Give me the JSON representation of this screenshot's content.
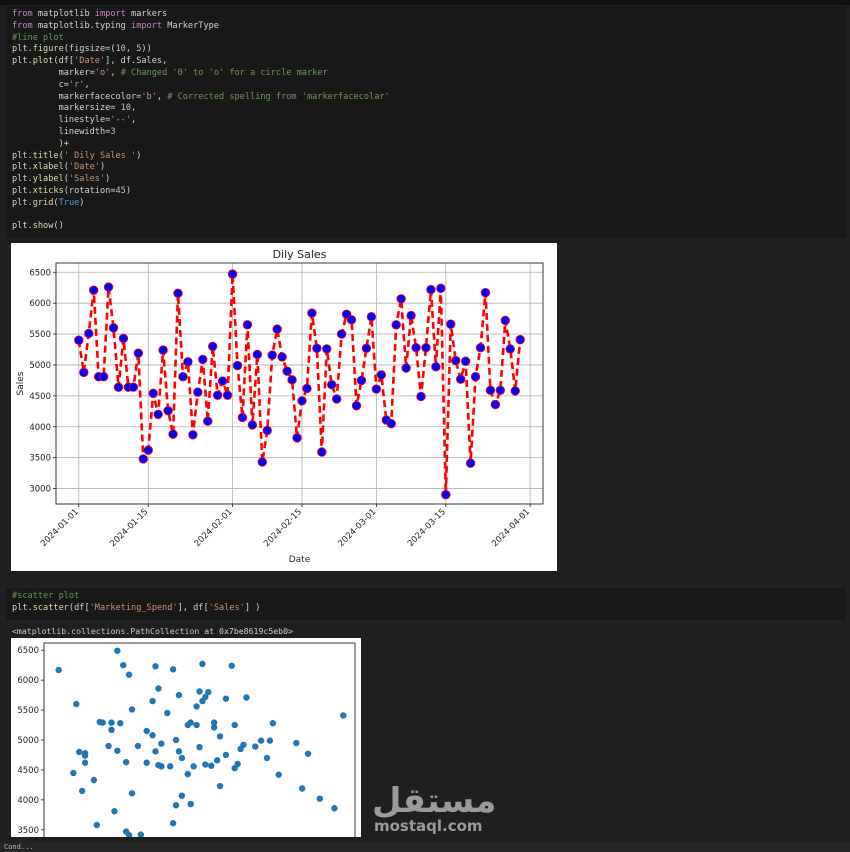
{
  "code_cell_1": [
    [
      [
        "kw",
        "from"
      ],
      [
        "t",
        " matplotlib "
      ],
      [
        "kw",
        "import"
      ],
      [
        "t",
        " markers"
      ]
    ],
    [
      [
        "kw",
        "from"
      ],
      [
        "t",
        " matplotlib.typing "
      ],
      [
        "kw",
        "import"
      ],
      [
        "t",
        " MarkerType"
      ]
    ],
    [
      [
        "cm",
        "#line plot"
      ]
    ],
    [
      [
        "t",
        "plt."
      ],
      [
        "fn",
        "figure"
      ],
      [
        "t",
        "(figsize=("
      ],
      [
        "num",
        "10"
      ],
      [
        "t",
        ", "
      ],
      [
        "num",
        "5"
      ],
      [
        "t",
        "))"
      ]
    ],
    [
      [
        "t",
        "plt."
      ],
      [
        "fn",
        "plot"
      ],
      [
        "t",
        "(df["
      ],
      [
        "str",
        "'Date'"
      ],
      [
        "t",
        "], df.Sales,"
      ]
    ],
    [
      [
        "t",
        "         marker="
      ],
      [
        "str",
        "'o'"
      ],
      [
        "t",
        ", "
      ],
      [
        "cm",
        "# Changed '0' to 'o' for a circle marker"
      ]
    ],
    [
      [
        "t",
        "         c="
      ],
      [
        "str",
        "'r'"
      ],
      [
        "t",
        ","
      ]
    ],
    [
      [
        "t",
        "         markerfacecolor="
      ],
      [
        "str",
        "'b'"
      ],
      [
        "t",
        ", "
      ],
      [
        "cm",
        "# Corrected spelling from 'markerfacecolar'"
      ]
    ],
    [
      [
        "t",
        "         markersize= "
      ],
      [
        "num",
        "10"
      ],
      [
        "t",
        ","
      ]
    ],
    [
      [
        "t",
        "         linestyle="
      ],
      [
        "str",
        "'--'"
      ],
      [
        "t",
        ","
      ]
    ],
    [
      [
        "t",
        "         linewidth="
      ],
      [
        "num",
        "3"
      ]
    ],
    [
      [
        "t",
        "         )+"
      ]
    ],
    [
      [
        "t",
        "plt."
      ],
      [
        "fn",
        "title"
      ],
      [
        "t",
        "("
      ],
      [
        "str",
        "' Dily Sales '"
      ],
      [
        "t",
        ")"
      ]
    ],
    [
      [
        "t",
        "plt."
      ],
      [
        "fn",
        "xlabel"
      ],
      [
        "t",
        "("
      ],
      [
        "str",
        "'Date'"
      ],
      [
        "t",
        ")"
      ]
    ],
    [
      [
        "t",
        "plt."
      ],
      [
        "fn",
        "ylabel"
      ],
      [
        "t",
        "("
      ],
      [
        "str",
        "'Sales'"
      ],
      [
        "t",
        ")"
      ]
    ],
    [
      [
        "t",
        "plt."
      ],
      [
        "fn",
        "xticks"
      ],
      [
        "t",
        "(rotation="
      ],
      [
        "num",
        "45"
      ],
      [
        "t",
        ")"
      ]
    ],
    [
      [
        "t",
        "plt."
      ],
      [
        "fn",
        "grid"
      ],
      [
        "t",
        "("
      ],
      [
        "cn",
        "True"
      ],
      [
        "t",
        ")"
      ]
    ],
    [
      [
        "t",
        ""
      ]
    ],
    [
      [
        "t",
        "plt."
      ],
      [
        "fn",
        "show"
      ],
      [
        "t",
        "()"
      ]
    ]
  ],
  "code_cell_2": [
    [
      [
        "cm",
        "#scatter plot"
      ]
    ],
    [
      [
        "t",
        "plt."
      ],
      [
        "fn",
        "scatter"
      ],
      [
        "t",
        "(df["
      ],
      [
        "str",
        "'Marketing_Spend'"
      ],
      [
        "t",
        "], df["
      ],
      [
        "str",
        "'Sales'"
      ],
      [
        "t",
        "] )"
      ]
    ]
  ],
  "scatter_output_text": "<matplotlib.collections.PathCollection at 0x7be8619c5eb0>",
  "watermark": {
    "arabic": "مستقل",
    "latin": "mostaql.com"
  },
  "bottom_label": "Cond...",
  "colors": {
    "line": "#ff0000",
    "marker_face": "#0000ff",
    "scatter": "#1f77b4"
  },
  "chart_data": [
    {
      "type": "line",
      "title": "Dily Sales",
      "xlabel": "Date",
      "ylabel": "Sales",
      "x_start": "2024-01-01",
      "x_ticks": [
        "2024-01-01",
        "2024-01-15",
        "2024-02-01",
        "2024-02-15",
        "2024-03-01",
        "2024-03-15",
        "2024-04-01"
      ],
      "y_ticks": [
        3000,
        3500,
        4000,
        4500,
        5000,
        5500,
        6000,
        6500
      ],
      "ylim": [
        2750,
        6650
      ],
      "grid": true,
      "x": [
        "2024-01-01",
        "2024-01-02",
        "2024-01-03",
        "2024-01-04",
        "2024-01-05",
        "2024-01-06",
        "2024-01-07",
        "2024-01-08",
        "2024-01-09",
        "2024-01-10",
        "2024-01-11",
        "2024-01-12",
        "2024-01-13",
        "2024-01-14",
        "2024-01-15",
        "2024-01-16",
        "2024-01-17",
        "2024-01-18",
        "2024-01-19",
        "2024-01-20",
        "2024-01-21",
        "2024-01-22",
        "2024-01-23",
        "2024-01-24",
        "2024-01-25",
        "2024-01-26",
        "2024-01-27",
        "2024-01-28",
        "2024-01-29",
        "2024-01-30",
        "2024-01-31",
        "2024-02-01",
        "2024-02-02",
        "2024-02-03",
        "2024-02-04",
        "2024-02-05",
        "2024-02-06",
        "2024-02-07",
        "2024-02-08",
        "2024-02-09",
        "2024-02-10",
        "2024-02-11",
        "2024-02-12",
        "2024-02-13",
        "2024-02-14",
        "2024-02-15",
        "2024-02-16",
        "2024-02-17",
        "2024-02-18",
        "2024-02-19",
        "2024-02-20",
        "2024-02-21",
        "2024-02-22",
        "2024-02-23",
        "2024-02-24",
        "2024-02-25",
        "2024-02-26",
        "2024-02-27",
        "2024-02-28",
        "2024-02-29",
        "2024-03-01",
        "2024-03-02",
        "2024-03-03",
        "2024-03-04",
        "2024-03-05",
        "2024-03-06",
        "2024-03-07",
        "2024-03-08",
        "2024-03-09",
        "2024-03-10",
        "2024-03-11",
        "2024-03-12",
        "2024-03-13",
        "2024-03-14",
        "2024-03-15",
        "2024-03-16",
        "2024-03-17",
        "2024-03-18",
        "2024-03-19",
        "2024-03-20",
        "2024-03-21",
        "2024-03-22",
        "2024-03-23",
        "2024-03-24",
        "2024-03-25",
        "2024-03-26",
        "2024-03-27",
        "2024-03-28",
        "2024-03-29",
        "2024-03-30"
      ],
      "y": [
        5400,
        4880,
        5510,
        6210,
        4810,
        4810,
        6260,
        5600,
        4640,
        5430,
        4640,
        4640,
        5190,
        3480,
        3620,
        4540,
        4200,
        5240,
        4260,
        3880,
        6160,
        4810,
        5050,
        3870,
        4560,
        5090,
        4090,
        5300,
        4510,
        4740,
        4510,
        6470,
        4990,
        4150,
        5650,
        4030,
        5170,
        3430,
        3940,
        5160,
        5580,
        5130,
        4900,
        4760,
        3820,
        4420,
        4620,
        5840,
        5270,
        3590,
        5260,
        4680,
        4450,
        5500,
        5820,
        5730,
        4340,
        4750,
        5270,
        5780,
        4610,
        4840,
        4110,
        4050,
        5650,
        6070,
        4950,
        5800,
        5280,
        4490,
        5280,
        6220,
        4970,
        6240,
        2900,
        5660,
        5070,
        4770,
        5060,
        3410,
        4810,
        5280,
        6170,
        4590,
        4360,
        4590,
        5720,
        5260,
        4580,
        5410
      ]
    },
    {
      "type": "scatter",
      "title": "",
      "xlabel": "",
      "ylabel": "",
      "y_ticks": [
        3500,
        4000,
        4500,
        5000,
        5500,
        6000,
        6500
      ],
      "ylim": [
        3380,
        6620
      ],
      "points": [
        [
          3,
          6170
        ],
        [
          8,
          4450
        ],
        [
          9,
          5600
        ],
        [
          10,
          4800
        ],
        [
          11,
          4150
        ],
        [
          12,
          4620
        ],
        [
          12,
          4740
        ],
        [
          15,
          4330
        ],
        [
          16,
          3580
        ],
        [
          17,
          5300
        ],
        [
          18,
          5290
        ],
        [
          20,
          4900
        ],
        [
          21,
          5170
        ],
        [
          21,
          5290
        ],
        [
          22,
          3810
        ],
        [
          23,
          4820
        ],
        [
          23,
          6490
        ],
        [
          24,
          5280
        ],
        [
          25,
          6250
        ],
        [
          26,
          4630
        ],
        [
          26,
          3470
        ],
        [
          27,
          6090
        ],
        [
          27,
          3410
        ],
        [
          28,
          5510
        ],
        [
          28,
          4110
        ],
        [
          31,
          3420
        ],
        [
          33,
          5150
        ],
        [
          33,
          4620
        ],
        [
          35,
          5080
        ],
        [
          35,
          5650
        ],
        [
          36,
          4810
        ],
        [
          36,
          6230
        ],
        [
          37,
          5860
        ],
        [
          37,
          4580
        ],
        [
          38,
          4940
        ],
        [
          38,
          4560
        ],
        [
          40,
          5450
        ],
        [
          41,
          4560
        ],
        [
          42,
          3610
        ],
        [
          42,
          6180
        ],
        [
          43,
          5000
        ],
        [
          43,
          3910
        ],
        [
          44,
          4810
        ],
        [
          44,
          5750
        ],
        [
          45,
          4700
        ],
        [
          45,
          4070
        ],
        [
          47,
          4430
        ],
        [
          47,
          5250
        ],
        [
          48,
          3930
        ],
        [
          48,
          5290
        ],
        [
          49,
          4560
        ],
        [
          50,
          5250
        ],
        [
          50,
          5560
        ],
        [
          51,
          4880
        ],
        [
          51,
          5810
        ],
        [
          52,
          5650
        ],
        [
          52,
          6270
        ],
        [
          53,
          4590
        ],
        [
          53,
          5720
        ],
        [
          54,
          5800
        ],
        [
          55,
          4570
        ],
        [
          56,
          5210
        ],
        [
          56,
          5290
        ],
        [
          57,
          4660
        ],
        [
          58,
          4230
        ],
        [
          60,
          5690
        ],
        [
          60,
          4750
        ],
        [
          62,
          6240
        ],
        [
          63,
          5250
        ],
        [
          63,
          4530
        ],
        [
          64,
          4600
        ],
        [
          65,
          4850
        ],
        [
          66,
          4920
        ],
        [
          67,
          5710
        ],
        [
          70,
          4890
        ],
        [
          72,
          4990
        ],
        [
          74,
          4700
        ],
        [
          75,
          4990
        ],
        [
          76,
          5280
        ],
        [
          78,
          4420
        ],
        [
          84,
          4950
        ],
        [
          86,
          4190
        ],
        [
          88,
          4770
        ],
        [
          92,
          4020
        ],
        [
          97,
          3860
        ],
        [
          100,
          5410
        ],
        [
          12,
          4780
        ],
        [
          30,
          4900
        ],
        [
          58,
          5060
        ]
      ]
    }
  ]
}
